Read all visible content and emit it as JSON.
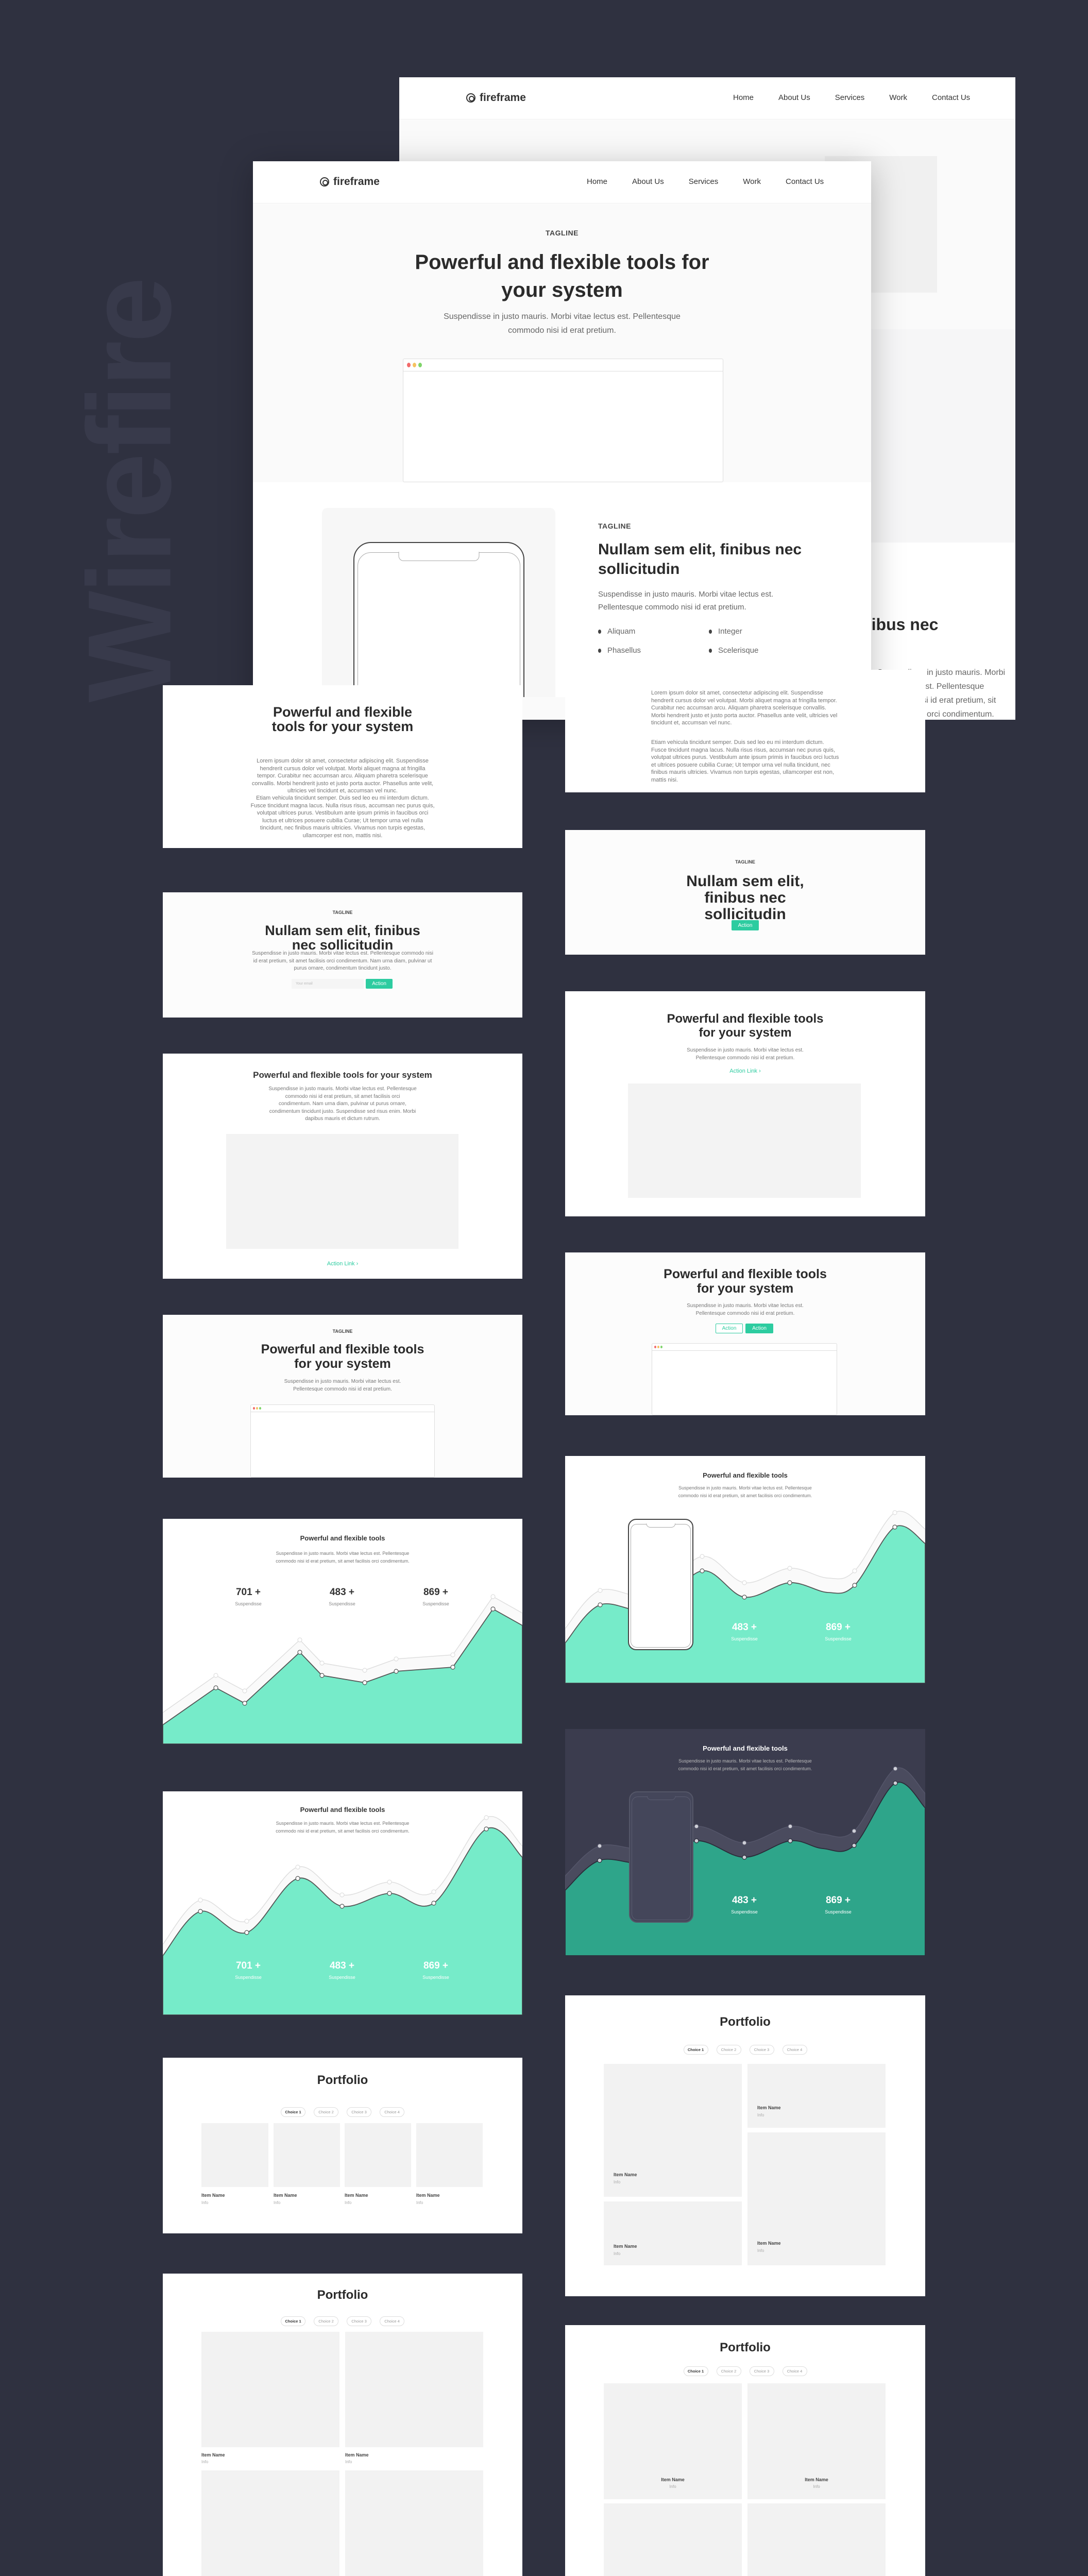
{
  "watermark": "Wirefire",
  "brand": "fireframe",
  "nav": [
    "Home",
    "About Us",
    "Services",
    "Work",
    "Contact Us"
  ],
  "colors": {
    "background": "#2f3140",
    "accent": "#2dcca0",
    "chart_fill": "#76ebc9",
    "dark_card": "#3b3c4e",
    "dark_chart_fill": "#2ea58a",
    "browser_dots": [
      "#f26b6b",
      "#f5c261",
      "#7fd46a"
    ]
  },
  "hero": {
    "tagline": "TAGLINE",
    "title": "Powerful and flexible tools for your system",
    "subtitle": "Suspendisse in justo mauris. Morbi vitae lectus est. Pellentesque commodo nisi id erat pretium."
  },
  "feature": {
    "tagline": "TAGLINE",
    "title": "Nullam sem elit, finibus nec sollicitudin",
    "body": "Suspendisse in justo mauris. Morbi vitae lectus est. Pellentesque commodo nisi id erat pretium.",
    "list": [
      "Aliquam",
      "Integer",
      "Phasellus",
      "Scelerisque"
    ]
  },
  "back_page": {
    "title": "Nullam sem elit, finibus nec sollicitudin",
    "body": "Suspendisse in justo mauris. Morbi vitae lectus est. Pellentesque commodo nisi id erat pretium, sit amet facilisis orci condimentum."
  },
  "text_blocks": {
    "title": "Powerful and flexible tools for your system",
    "p1": "Lorem ipsum dolor sit amet, consectetur adipiscing elit. Suspendisse hendrerit cursus dolor vel volutpat. Morbi aliquet magna at fringilla tempor. Curabitur nec accumsan arcu. Aliquam pharetra scelerisque convallis. Morbi hendrerit justo et justo porta auctor. Phasellus ante velit, ultricies vel tincidunt et, accumsan vel nunc.",
    "p2": "Etiam vehicula tincidunt semper. Duis sed leo eu mi interdum dictum. Fusce tincidunt magna lacus. Nulla risus risus, accumsan nec purus quis, volutpat ultrices purus. Vestibulum ante ipsum primis in faucibus orci luctus et ultrices posuere cubilia Curae; Ut tempor urna vel nulla tincidunt, nec finibus mauris ultricies. Vivamus non turpis egestas, ullamcorper est non, mattis nisi."
  },
  "cta_email": {
    "tagline": "TAGLINE",
    "title": "Nullam sem elit, finibus nec sollicitudin",
    "body": "Suspendisse in justo mauris. Morbi vitae lectus est. Pellentesque commodo nisi id erat pretium, sit amet facilisis orci condimentum. Nam urna diam, pulvinar ut purus ornare, condimentum tincidunt justo.",
    "email_placeholder": "Your email",
    "button": "Action"
  },
  "cta_simple": {
    "tagline": "TAGLINE",
    "title": "Nullam sem elit, finibus nec sollicitudin",
    "button": "Action"
  },
  "content_image": {
    "title": "Powerful and flexible tools for your system",
    "body": "Suspendisse in justo mauris. Morbi vitae lectus est. Pellentesque commodo nisi id erat pretium, sit amet facilisis orci condimentum. Nam urna diam, pulvinar ut purus ornare, condimentum tincidunt justo. Suspendisse sed risus enim. Morbi dapibus mauris et dictum rutrum.",
    "link": "Action Link ›"
  },
  "header_link": {
    "title": "Powerful and flexible tools for your system",
    "body": "Suspendisse in justo mauris. Morbi vitae lectus est. Pellentesque commodo nisi id erat pretium.",
    "link": "Action Link ›"
  },
  "header_browser": {
    "tagline": "TAGLINE",
    "title": "Powerful and flexible tools for your system",
    "body": "Suspendisse in justo mauris. Morbi vitae lectus est. Pellentesque commodo nisi id erat pretium."
  },
  "header_buttons": {
    "title": "Powerful and flexible tools for your system",
    "body": "Suspendisse in justo mauris. Morbi vitae lectus est. Pellentesque commodo nisi id erat pretium.",
    "button_outline": "Action",
    "button_filled": "Action"
  },
  "stats": {
    "title": "Powerful and flexible tools",
    "body": "Suspendisse in justo mauris. Morbi vitae lectus est. Pellentesque commodo nisi id erat pretium, sit amet facilisis orci condimentum.",
    "items": [
      {
        "value": "701 +",
        "label": "Suspendisse"
      },
      {
        "value": "483 +",
        "label": "Suspendisse"
      },
      {
        "value": "869 +",
        "label": "Suspendisse"
      }
    ]
  },
  "portfolio": {
    "title": "Portfolio",
    "choices": [
      "Choice 1",
      "Choice 2",
      "Choice 3",
      "Choice 4"
    ],
    "active_choice": "Choice 1",
    "item_name": "Item Name",
    "item_info": "Info"
  }
}
